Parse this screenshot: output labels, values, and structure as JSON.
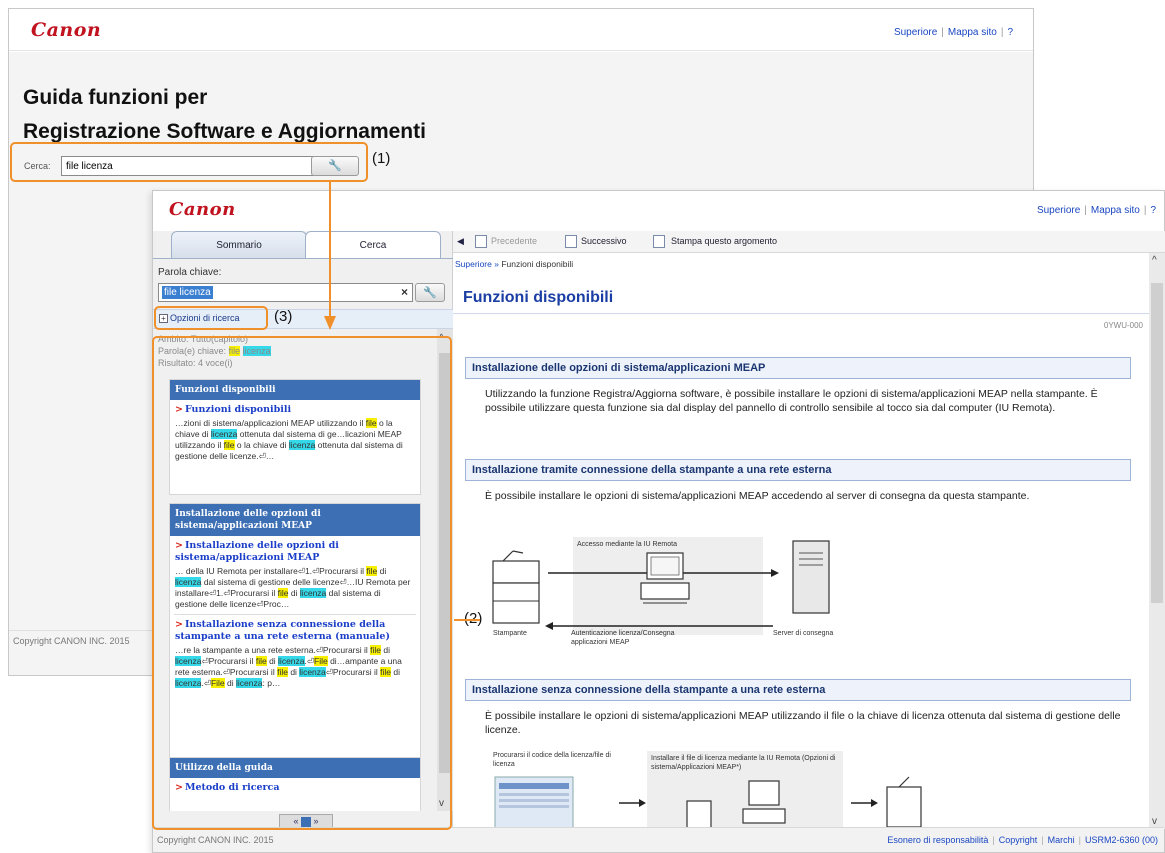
{
  "back_window": {
    "logo": "Canon",
    "top_links": [
      "Superiore",
      "Mappa sito",
      "?"
    ],
    "title_line1": "Guida funzioni per",
    "title_line2": "Registrazione Software e Aggiornamenti",
    "search_label": "Cerca:",
    "search_value": "file licenza",
    "search_button": "🔧",
    "footer": "Copyright CANON INC. 2015"
  },
  "front_window": {
    "logo": "Canon",
    "top_links": [
      "Superiore",
      "Mappa sito",
      "?"
    ],
    "tabs": [
      "Sommario",
      "Cerca"
    ],
    "keyword_label": "Parola chiave:",
    "keyword_value": "file licenza",
    "clear_symbol": "×",
    "search_button": "🔧",
    "options_label": "Opzioni di ricerca",
    "summary": {
      "ambito": "Ambito: Tutto(capitolo)",
      "parola_prefix": "Parola(e) chiave:",
      "kw1": "file",
      "kw2": "licenza",
      "risultato": "Risultato: 4 voce(i)"
    },
    "results": [
      {
        "group": "Funzioni disponibili",
        "title": "Funzioni disponibili",
        "snippet_parts": [
          "…zioni di sistema/applicazioni MEAP utilizzando il ",
          "file",
          " o la chiave di ",
          "licenza",
          " ottenuta dal sistema di ge…licazioni MEAP utilizzando il ",
          "file",
          " o la chiave di ",
          "licenza",
          " ottenuta dal sistema di gestione delle licenze.⏎…"
        ]
      },
      {
        "group": "Installazione delle opzioni di sistema/applicazioni MEAP",
        "title": "Installazione delle opzioni di sistema/applicazioni MEAP",
        "snippet_parts": [
          "… della IU Remota per installare⏎1.⏎Procurarsi il ",
          "file",
          " di ",
          "licenza",
          " dal sistema di gestione delle licenze⏎…IU Remota per installare⏎1.⏎Procurarsi il ",
          "file",
          " di ",
          "licenza",
          " dal sistema di gestione delle licenze⏎Proc…"
        ]
      },
      {
        "group": "",
        "title": "Installazione senza connessione della stampante a una rete esterna (manuale)",
        "snippet_parts": [
          "…re la stampante a una rete esterna.⏎Procurarsi il ",
          "file",
          " di ",
          "licenza",
          "⏎Procurarsi il ",
          "file",
          " di ",
          "licenza",
          ".⏎",
          "File",
          " di…ampante a una rete esterna.⏎Procurarsi il ",
          "file",
          " di ",
          "licenza",
          "⏎Procurarsi il ",
          "file",
          " di ",
          "licenza",
          ".⏎",
          "File",
          " di ",
          "licenza",
          ": p…"
        ]
      },
      {
        "group": "Utilizzo della guida",
        "title": "Metodo di ricerca",
        "snippet_parts": []
      }
    ],
    "pager": "«  »",
    "nav": {
      "previous": "Precedente",
      "next": "Successivo",
      "print": "Stampa questo argomento"
    },
    "breadcrumb_link": "Superiore",
    "breadcrumb_current": "Funzioni disponibili",
    "page_title": "Funzioni disponibili",
    "doc_id": "0YWU-000",
    "sections": [
      {
        "heading": "Installazione delle opzioni di sistema/applicazioni MEAP",
        "text": "Utilizzando la funzione Registra/Aggiorna software, è possibile installare le opzioni di sistema/applicazioni MEAP nella stampante. È possibile utilizzare questa funzione sia dal display del pannello di controllo sensibile al tocco sia dal computer (IU Remota)."
      },
      {
        "heading": "Installazione tramite connessione della stampante a una rete esterna",
        "text": "È possibile installare le opzioni di sistema/applicazioni MEAP accedendo al server di consegna da questa stampante."
      },
      {
        "heading": "Installazione senza connessione della stampante a una rete esterna",
        "text": "È possibile installare le opzioni di sistema/applicazioni MEAP utilizzando il file o la chiave di licenza ottenuta dal sistema di gestione delle licenze."
      }
    ],
    "figure1": {
      "access_label": "Accesso mediante la IU Remota",
      "printer_label": "Stampante",
      "server_label": "Server di consegna",
      "auth_label": "Autenticazione licenza/Consegna applicazioni MEAP"
    },
    "figure2": {
      "left_label": "Procurarsi il codice della licenza/file di licenza",
      "right_label": "Installare il file di licenza mediante la IU Remota (Opzioni di sistema/Applicazioni MEAP*)"
    },
    "footer_copy": "Copyright CANON INC. 2015",
    "footer_links": [
      "Esonero di responsabilità",
      "Copyright",
      "Marchi",
      "USRM2-6360 (00)"
    ]
  },
  "annotations": [
    "(1)",
    "(2)",
    "(3)"
  ],
  "colors": {
    "annotation": "#f0902a",
    "canon_red": "#c1121f",
    "link_blue": "#1a47c2"
  }
}
